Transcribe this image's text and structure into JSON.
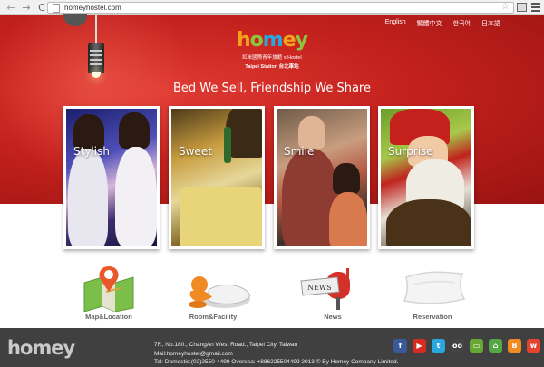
{
  "browser": {
    "url": "homeyhostel.com",
    "back_glyph": "←",
    "forward_glyph": "→",
    "reload_glyph": "C",
    "star_glyph": "☆"
  },
  "header": {
    "languages": [
      "English",
      "繁體中文",
      "한국어",
      "日本語"
    ],
    "logo": {
      "wordmark": [
        "h",
        "o",
        "m",
        "e",
        "y"
      ],
      "subtitle_zh": "紅米國際青年旅館 x Hostel",
      "station_line": "Taipei Station 台北車站"
    },
    "tagline": "Bed We Sell, Friendship We Share"
  },
  "photos": [
    {
      "caption": "Stylish"
    },
    {
      "caption": "Sweet"
    },
    {
      "caption": "Smile"
    },
    {
      "caption": "Surprise"
    }
  ],
  "features": [
    {
      "label": "Map&Location",
      "icon": "map-location-icon"
    },
    {
      "label": "Room&Facility",
      "icon": "room-facility-icon"
    },
    {
      "label": "News",
      "icon": "news-mailbox-icon"
    },
    {
      "label": "Reservation",
      "icon": "reservation-pillow-icon"
    }
  ],
  "footer": {
    "logo": "homey",
    "address": "7F., No.180., ChangAn West Road., Taipei City, Taiwan",
    "mail": "Mail:homeyhostel@gmail.com",
    "tel": "Tel: Domestic:(02)2550-4499    Oversea: +886225504499    2013 © By Homey Company Limited.",
    "social": [
      {
        "name": "facebook-icon",
        "glyph": "f",
        "color": "#3b5998"
      },
      {
        "name": "youtube-icon",
        "glyph": "▶",
        "color": "#d62b20"
      },
      {
        "name": "twitter-icon",
        "glyph": "t",
        "color": "#2aa7e0"
      },
      {
        "name": "tripadvisor-icon",
        "glyph": "oo",
        "color": "#444444"
      },
      {
        "name": "hostel-booking-icon",
        "glyph": "▭",
        "color": "#66a831"
      },
      {
        "name": "home-icon",
        "glyph": "⌂",
        "color": "#56a847"
      },
      {
        "name": "blogger-icon",
        "glyph": "B",
        "color": "#f18a22"
      },
      {
        "name": "weibo-icon",
        "glyph": "w",
        "color": "#e6432f"
      }
    ]
  }
}
